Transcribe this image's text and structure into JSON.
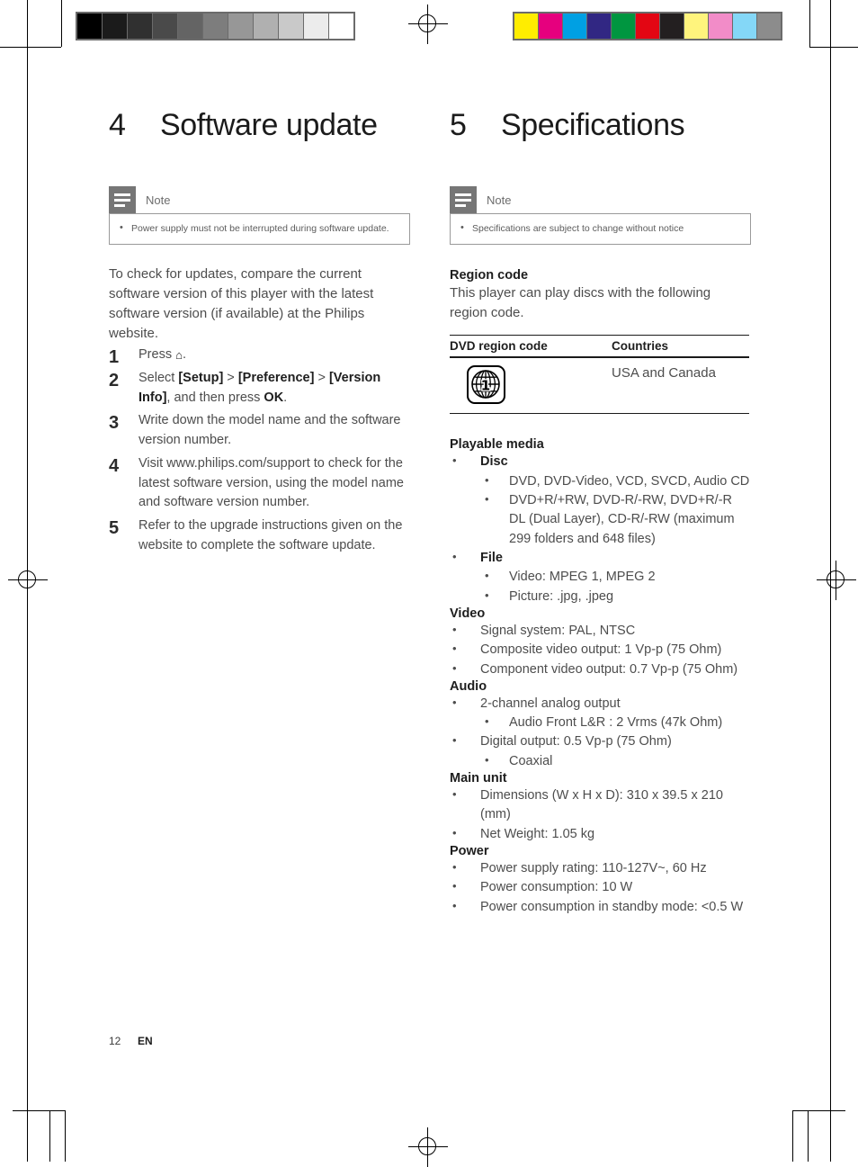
{
  "marks": {
    "grayscale_patches": [
      "#000000",
      "#1b1b1b",
      "#303030",
      "#4a4a4a",
      "#646464",
      "#7d7d7d",
      "#979797",
      "#b0b0b0",
      "#c9c9c9",
      "#ececec",
      "#ffffff"
    ],
    "color_patches": [
      "#ffed00",
      "#e6007e",
      "#00a0e3",
      "#312783",
      "#009640",
      "#e30613",
      "#231f20",
      "#fff47d",
      "#f28cc8",
      "#84d7f7",
      "#8c8c8c"
    ]
  },
  "left_column": {
    "chapter_number": "4",
    "chapter_title": "Software update",
    "note": {
      "title": "Note",
      "items": [
        "Power supply must not be interrupted during software update."
      ]
    },
    "intro": "To check for updates, compare the current software version of this player with the latest software version (if available) at the Philips website.",
    "steps": [
      {
        "num": "1",
        "pre": "Press ",
        "glyph": "⌂",
        "post": "."
      },
      {
        "num": "2",
        "pre": "Select ",
        "b1": "[Setup]",
        "s1": " > ",
        "b2": "[Preference]",
        "s2": " > ",
        "b3": "[Version Info]",
        "s3": ", and then press ",
        "b4": "OK",
        "s4": "."
      },
      {
        "num": "3",
        "text": "Write down the model name and the software version number."
      },
      {
        "num": "4",
        "text": "Visit www.philips.com/support to check for the latest software version, using the model name and software version number."
      },
      {
        "num": "5",
        "text": "Refer to the upgrade instructions given on the website to complete the software update."
      }
    ]
  },
  "right_column": {
    "chapter_number": "5",
    "chapter_title": "Specifications",
    "note": {
      "title": "Note",
      "items": [
        "Specifications are subject to change without notice"
      ]
    },
    "region": {
      "heading": "Region code",
      "description": "This player can play discs with the following region code.",
      "table": {
        "headers": [
          "DVD region code",
          "Countries"
        ],
        "rows": [
          {
            "icon": "dvd-region-1-globe-icon",
            "region_digit": "1",
            "countries": "USA and Canada"
          }
        ]
      }
    },
    "sections": [
      {
        "heading": "Playable media",
        "items": [
          {
            "label": "Disc",
            "bold": true,
            "children": [
              "DVD, DVD-Video, VCD, SVCD, Audio CD",
              "DVD+R/+RW, DVD-R/-RW, DVD+R/-R DL (Dual Layer), CD-R/-RW (maximum 299 folders and 648 files)"
            ]
          },
          {
            "label": "File",
            "bold": true,
            "children": [
              "Video: MPEG 1, MPEG 2",
              "Picture: .jpg, .jpeg"
            ]
          }
        ]
      },
      {
        "heading": "Video",
        "items": [
          {
            "label": "Signal system: PAL, NTSC",
            "bold": false,
            "children": []
          },
          {
            "label": "Composite video output: 1 Vp-p (75 Ohm)",
            "bold": false,
            "children": []
          },
          {
            "label": "Component video output: 0.7 Vp-p (75 Ohm)",
            "bold": false,
            "children": []
          }
        ]
      },
      {
        "heading": "Audio",
        "items": [
          {
            "label": "2-channel analog output",
            "bold": false,
            "children": [
              "Audio Front L&R : 2 Vrms (47k Ohm)"
            ]
          },
          {
            "label": "Digital output: 0.5 Vp-p (75 Ohm)",
            "bold": false,
            "children": [
              "Coaxial"
            ]
          }
        ]
      },
      {
        "heading": "Main unit",
        "items": [
          {
            "label": "Dimensions (W x H x D): 310 x 39.5 x 210 (mm)",
            "bold": false,
            "children": []
          },
          {
            "label": "Net Weight: 1.05 kg",
            "bold": false,
            "children": []
          }
        ]
      },
      {
        "heading": "Power",
        "items": [
          {
            "label": "Power supply rating: 110-127V~, 60 Hz",
            "bold": false,
            "children": []
          },
          {
            "label": "Power consumption: 10 W",
            "bold": false,
            "children": []
          },
          {
            "label": "Power consumption in standby mode: <0.5 W",
            "bold": false,
            "children": []
          }
        ]
      }
    ]
  },
  "footer": {
    "page_number": "12",
    "language": "EN"
  }
}
